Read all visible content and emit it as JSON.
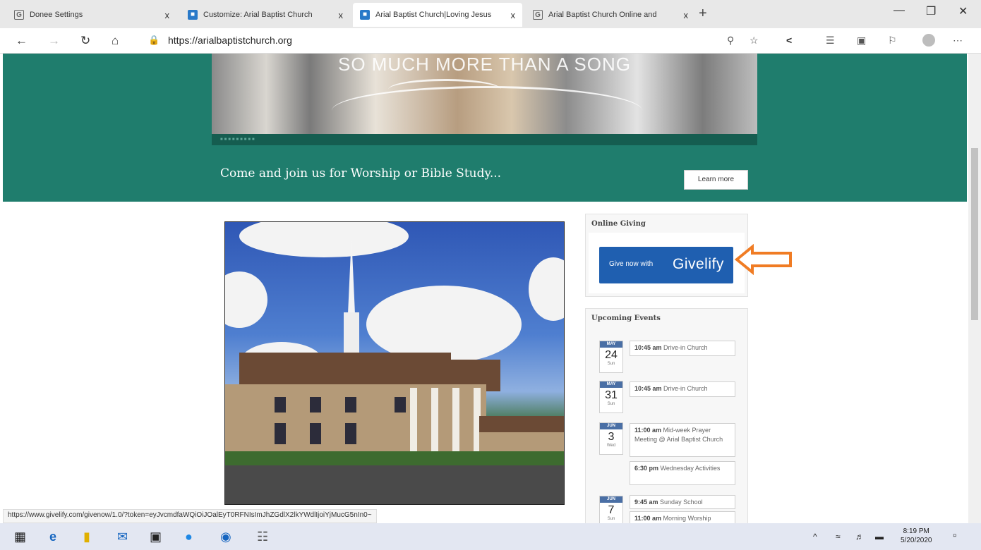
{
  "browser": {
    "tabs": [
      {
        "title": "Donee Settings",
        "icon": "google-icon"
      },
      {
        "title": "Customize: Arial Baptist Church",
        "icon": "site-icon"
      },
      {
        "title": "Arial Baptist Church|Loving Jesus",
        "icon": "site-icon",
        "active": true
      },
      {
        "title": "Arial Baptist Church Online and",
        "icon": "google-icon"
      }
    ],
    "close_glyph": "x",
    "new_tab_glyph": "+",
    "url": "https://arialbaptistchurch.org"
  },
  "hero": {
    "banner_text": "SO MUCH MORE THAN A SONG",
    "tagline": "Come and join us for Worship or Bible Study...",
    "learn_more": "Learn more"
  },
  "sidebar": {
    "giving_title": "Online Giving",
    "give_small": "Give now with",
    "give_brand": "Givelify",
    "events_title": "Upcoming Events",
    "events": [
      {
        "month": "MAY",
        "day": "24",
        "weekday": "Sun",
        "items": [
          {
            "time": "10:45 am",
            "title": "Drive-in Church"
          }
        ]
      },
      {
        "month": "MAY",
        "day": "31",
        "weekday": "Sun",
        "items": [
          {
            "time": "10:45 am",
            "title": "Drive-in Church"
          }
        ]
      },
      {
        "month": "JUN",
        "day": "3",
        "weekday": "Wed",
        "items": [
          {
            "time": "11:00 am",
            "title": "Mid-week Prayer Meeting @ Arial Baptist Church"
          },
          {
            "time": "6:30 pm",
            "title": "Wednesday Activities"
          }
        ]
      },
      {
        "month": "JUN",
        "day": "7",
        "weekday": "Sun",
        "items": [
          {
            "time": "9:45 am",
            "title": "Sunday School"
          },
          {
            "time": "11:00 am",
            "title": "Morning Worship"
          }
        ]
      }
    ]
  },
  "status_url": "https://www.givelify.com/givenow/1.0/?token=eyJvcmdfaWQiOiJOalEyT0RFNIsImJhZGdlX2lkYWdlIjoiYjMucG5nIn0~",
  "taskbar": {
    "time": "8:19 PM",
    "date": "5/20/2020"
  },
  "colors": {
    "hero_bg": "#1f7d6d",
    "givelify_blue": "#1f5fb0",
    "arrow_orange": "#f07c24"
  }
}
